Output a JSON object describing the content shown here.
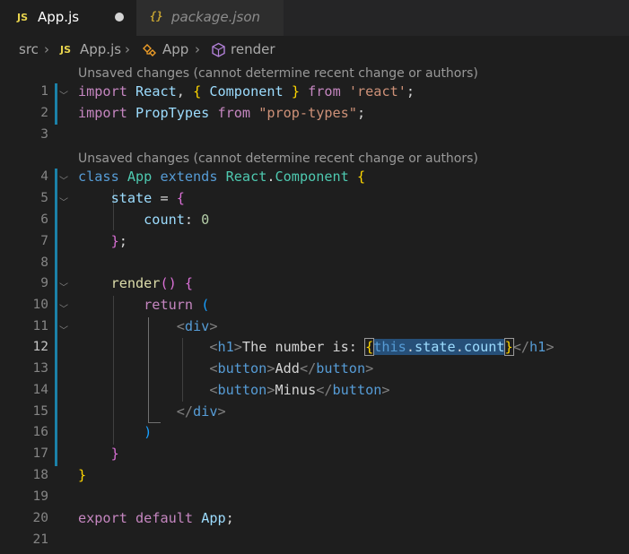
{
  "tabs": [
    {
      "icon": "JS",
      "label": "App.js",
      "dirty": true
    },
    {
      "icon": "{}",
      "label": "package.json"
    }
  ],
  "breadcrumb": {
    "folder": "src",
    "file_icon": "JS",
    "file": "App.js",
    "class_icon": "class-icon",
    "class": "App",
    "method_icon": "method-icon",
    "method": "render"
  },
  "codelens": [
    "Unsaved changes (cannot determine recent change or authors)",
    "Unsaved changes (cannot determine recent change or authors)"
  ],
  "line_numbers": [
    "1",
    "2",
    "3",
    "4",
    "5",
    "6",
    "7",
    "8",
    "9",
    "10",
    "11",
    "12",
    "13",
    "14",
    "15",
    "16",
    "17",
    "18",
    "19",
    "20",
    "21"
  ],
  "code": {
    "l1": {
      "import": "import",
      "react": "React",
      "comma": ",",
      "ob": "{",
      "component": "Component",
      "cb": "}",
      "from": "from",
      "module": "'react'",
      "semi": ";"
    },
    "l2": {
      "import": "import",
      "name": "PropTypes",
      "from": "from",
      "module": "\"prop-types\"",
      "semi": ";"
    },
    "l4": {
      "class": "class",
      "name": "App",
      "extends": "extends",
      "base": "React",
      "dot": ".",
      "component": "Component",
      "ob": "{"
    },
    "l5": {
      "state": "state",
      "eq": " = ",
      "ob": "{"
    },
    "l6": {
      "count": "count",
      "colon": ": ",
      "zero": "0"
    },
    "l7": {
      "cb": "}",
      "semi": ";"
    },
    "l9": {
      "render": "render",
      "parens": "()",
      "ob": "{"
    },
    "l10": {
      "return": "return",
      "op": "("
    },
    "l11": {
      "open": "<",
      "tag": "div",
      "close": ">"
    },
    "l12": {
      "open": "<",
      "tag": "h1",
      "close": ">",
      "text": "The number is: ",
      "ob": "{",
      "this": "this",
      "dot1": ".",
      "state": "state",
      "dot2": ".",
      "count": "count",
      "cb": "}",
      "end_open": "</",
      "end_tag": "h1",
      "end_close": ">"
    },
    "l13": {
      "open": "<",
      "tag": "button",
      "close": ">",
      "text": "Add",
      "end_open": "</",
      "end_tag": "button",
      "end_close": ">"
    },
    "l14": {
      "open": "<",
      "tag": "button",
      "close": ">",
      "text": "Minus",
      "end_open": "</",
      "end_tag": "button",
      "end_close": ">"
    },
    "l15": {
      "end_open": "</",
      "tag": "div",
      "end_close": ">"
    },
    "l16": {
      "cp": ")"
    },
    "l17": {
      "cb": "}"
    },
    "l18": {
      "cb": "}"
    },
    "l20": {
      "export": "export",
      "default": "default",
      "name": "App",
      "semi": ";"
    }
  },
  "colors": {
    "background": "#1e1e1e",
    "keyword": "#c586c0",
    "class": "#4ec9b0",
    "variable": "#9cdcfe",
    "string": "#ce9178",
    "gutter_indicator": "#1b81a8"
  }
}
